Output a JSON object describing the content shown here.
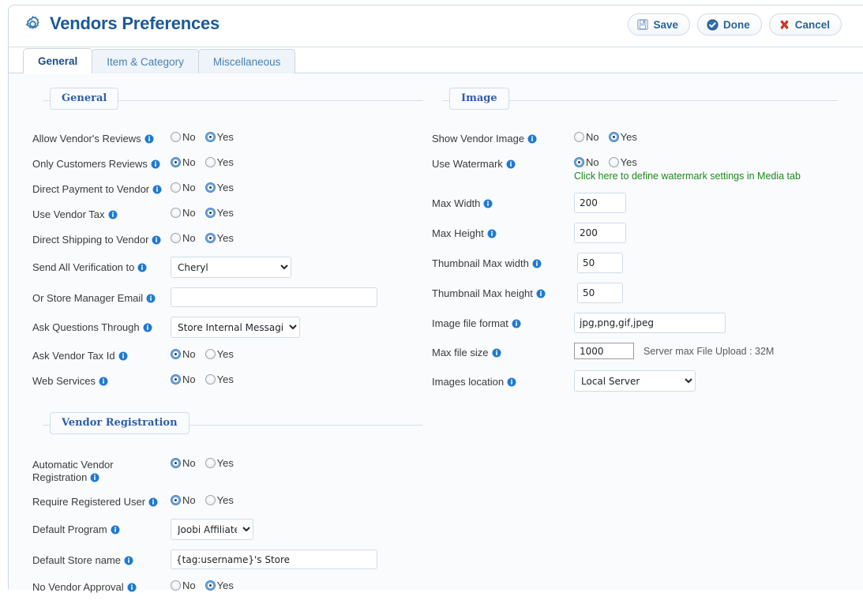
{
  "header": {
    "title": "Vendors Preferences",
    "gear_icon": "gear-icon",
    "buttons": [
      {
        "label": "Save",
        "icon": "save-disk-icon"
      },
      {
        "label": "Done",
        "icon": "check-circle-icon"
      },
      {
        "label": "Cancel",
        "icon": "red-x-icon"
      }
    ]
  },
  "tabs": [
    {
      "label": "General",
      "active": true
    },
    {
      "label": "Item & Category",
      "active": false
    },
    {
      "label": "Miscellaneous",
      "active": false
    }
  ],
  "colors": {
    "title_blue": "#1c5998",
    "legend_blue": "#2f5fa8",
    "green_link": "#1a8a1a",
    "radio_on": "#6ea8dd",
    "border": "#c9d6e2"
  },
  "radio_labels": {
    "no": "No",
    "yes": "Yes"
  },
  "sections": {
    "general": {
      "legend": "General",
      "fields": [
        {
          "label": "Allow Vendor's Reviews",
          "type": "radio",
          "value": "Yes"
        },
        {
          "label": "Only Customers Reviews",
          "type": "radio",
          "value": "No"
        },
        {
          "label": "Direct Payment to Vendor",
          "type": "radio",
          "value": "Yes"
        },
        {
          "label": "Use Vendor Tax",
          "type": "radio",
          "value": "Yes"
        },
        {
          "label": "Direct Shipping to Vendor",
          "type": "radio",
          "value": "Yes"
        },
        {
          "label": "Send All Verification to",
          "type": "select",
          "value": "Cheryl"
        },
        {
          "label": "Or Store Manager Email",
          "type": "text",
          "value": "",
          "placeholder": ""
        },
        {
          "label": "Ask Questions Through",
          "type": "select",
          "value": "Store Internal Messaging"
        },
        {
          "label": "Ask Vendor Tax Id",
          "type": "radio",
          "value": "No"
        },
        {
          "label": "Web Services",
          "type": "radio",
          "value": "No"
        }
      ]
    },
    "vendor_registration": {
      "legend": "Vendor Registration",
      "fields": [
        {
          "label": "Automatic Vendor Registration",
          "type": "radio",
          "value": "No"
        },
        {
          "label": "Require Registered User",
          "type": "radio",
          "value": "No"
        },
        {
          "label": "Default Program",
          "type": "select",
          "value": "Joobi Affiliate"
        },
        {
          "label": "Default Store name",
          "type": "text",
          "value": "{tag:username}'s Store",
          "placeholder": ""
        },
        {
          "label": "No Vendor Approval",
          "type": "radio",
          "value": "Yes"
        }
      ]
    },
    "image": {
      "legend": "Image",
      "fields": [
        {
          "label": "Show Vendor Image",
          "type": "radio",
          "value": "Yes"
        },
        {
          "label": "Use Watermark",
          "type": "radio",
          "value": "No",
          "note": "Click here to define watermark settings in Media tab"
        },
        {
          "label": "Max Width",
          "type": "text",
          "value": "200"
        },
        {
          "label": "Max Height",
          "type": "text",
          "value": "200"
        },
        {
          "label": "Thumbnail Max width",
          "type": "text",
          "value": "50"
        },
        {
          "label": "Thumbnail Max height",
          "type": "text",
          "value": "50"
        },
        {
          "label": "Image file format",
          "type": "text",
          "value": "jpg,png,gif,jpeg"
        },
        {
          "label": "Max file size",
          "type": "text",
          "value": "1000",
          "hint": "Server max File Upload : 32M"
        },
        {
          "label": "Images location",
          "type": "select",
          "value": "Local Server"
        }
      ]
    }
  }
}
